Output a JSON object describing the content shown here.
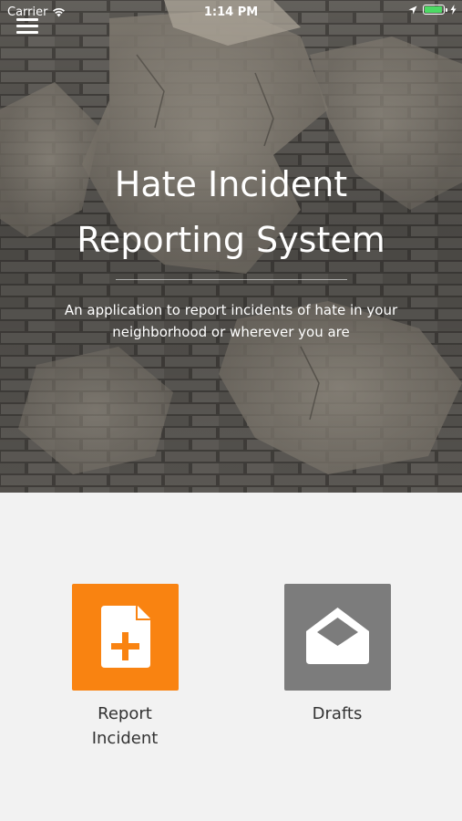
{
  "status_bar": {
    "carrier": "Carrier",
    "time": "1:14 PM",
    "battery_color": "#4cd964"
  },
  "header": {
    "menu_icon": "hamburger-menu-icon",
    "title_line1": "Hate Incident",
    "title_line2": "Reporting System",
    "subtitle_line1": "An application to report incidents of hate in your",
    "subtitle_line2": "neighborhood or wherever you are"
  },
  "actions": {
    "report": {
      "label_line1": "Report",
      "label_line2": "Incident",
      "icon": "new-document-icon",
      "color": "#f98311"
    },
    "drafts": {
      "label": "Drafts",
      "icon": "envelope-open-icon",
      "color": "#7c7c7c"
    }
  },
  "colors": {
    "background": "#f2f2f2",
    "text": "#333333"
  }
}
